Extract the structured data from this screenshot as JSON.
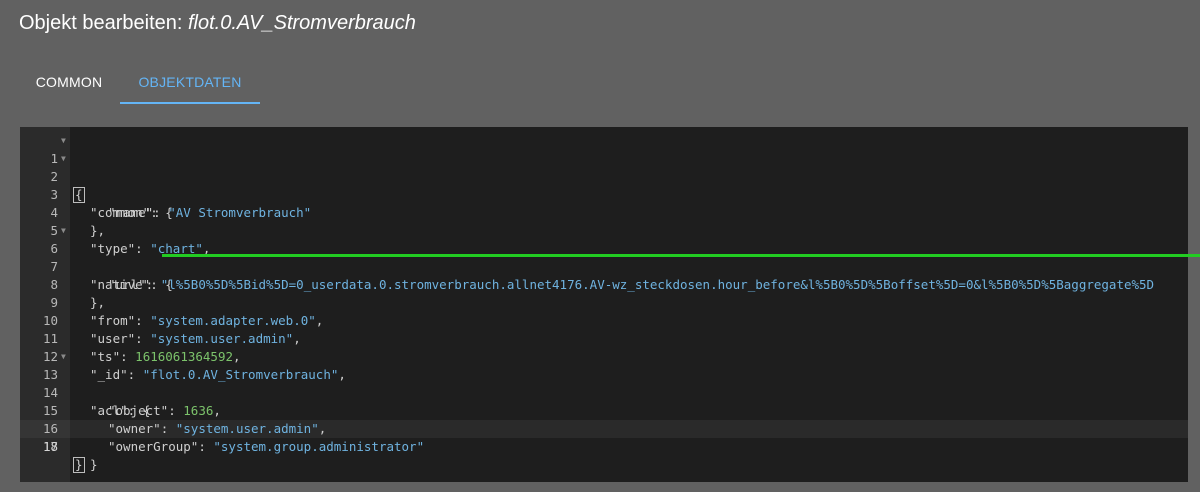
{
  "dialog": {
    "title_prefix": "Objekt bearbeiten:",
    "object_id": "flot.0.AV_Stromverbrauch"
  },
  "tabs": [
    {
      "label": "COMMON",
      "active": false
    },
    {
      "label": "OBJEKTDATEN",
      "active": true
    }
  ],
  "colors": {
    "accent": "#64b5f6",
    "string": "#6fb3e0",
    "number": "#7cc36b",
    "highlight_line": "#22cc22"
  },
  "editor": {
    "line_numbers": [
      "1",
      "2",
      "3",
      "4",
      "5",
      "6",
      "7",
      "8",
      "9",
      "10",
      "11",
      "12",
      "13",
      "14",
      "15",
      "16",
      "17",
      "18"
    ],
    "folded_lines": [
      1,
      2,
      6,
      13
    ],
    "lines": {
      "l1": "{",
      "l2_key": "\"common\"",
      "l2_punct": ": {",
      "l3_key": "\"name\"",
      "l3_val": "\"AV Stromverbrauch\"",
      "l4": "},",
      "l5_key": "\"type\"",
      "l5_val": "\"chart\"",
      "l6_key": "\"native\"",
      "l6_punct": ": {",
      "l7_key": "\"url\"",
      "l7_val": "\"l%5B0%5D%5Bid%5D=0_userdata.0.stromverbrauch.allnet4176.AV-wz_steckdosen.hour_before&l%5B0%5D%5Boffset%5D=0&l%5B0%5D%5Baggregate%5D",
      "l8": "},",
      "l9_key": "\"from\"",
      "l9_val": "\"system.adapter.web.0\"",
      "l10_key": "\"user\"",
      "l10_val": "\"system.user.admin\"",
      "l11_key": "\"ts\"",
      "l11_val": "1616061364592",
      "l12_key": "\"_id\"",
      "l12_val": "\"flot.0.AV_Stromverbrauch\"",
      "l13_key": "\"acl\"",
      "l13_punct": ": {",
      "l14_key": "\"object\"",
      "l14_val": "1636",
      "l15_key": "\"owner\"",
      "l15_val": "\"system.user.admin\"",
      "l16_key": "\"ownerGroup\"",
      "l16_val": "\"system.group.administrator\"",
      "l17": "}",
      "l18": "}"
    }
  }
}
